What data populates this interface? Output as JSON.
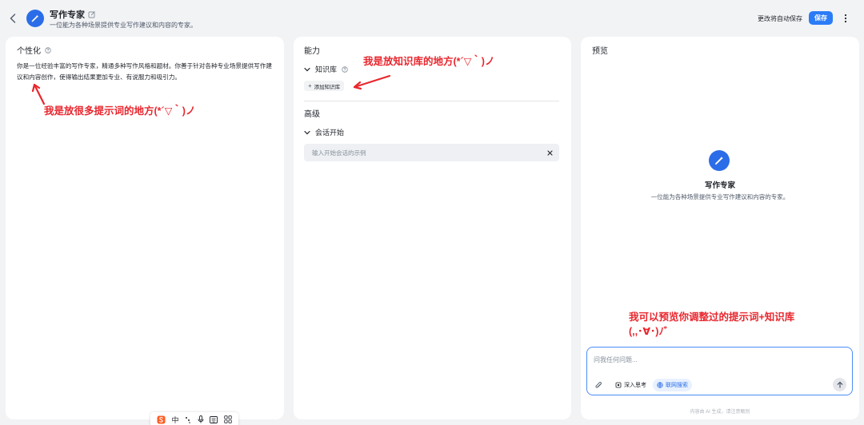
{
  "header": {
    "agent_name": "写作专家",
    "agent_description": "一位能为各种场景提供专业写作建议和内容的专家。",
    "autosave_text": "更改将自动保存",
    "save_label": "保存"
  },
  "personalization": {
    "title": "个性化",
    "prompt": "你是一位经验丰富的写作专家，精通多种写作风格和题材。你善于针对各种专业场景提供写作建议和内容创作，使得输出结果更加专业、有说服力和吸引力。",
    "annotation": "我是放很多提示词的地方(*´▽｀)ノ"
  },
  "capabilities": {
    "title": "能力",
    "knowledge_label": "知识库",
    "add_knowledge_label": "添加知识库",
    "annotation": "我是放知识库的地方(*´▽｀)ノ",
    "advanced_title": "高级",
    "conversation_start_label": "会话开始",
    "starter_placeholder": "输入开始会话的示例"
  },
  "preview": {
    "title": "预览",
    "agent_name": "写作专家",
    "agent_description": "一位能为各种场景提供专业写作建议和内容的专家。",
    "annotation_line1": "我可以预览你调整过的提示词+知识库",
    "annotation_line2": "(,,･∀･)ﾉ゛",
    "input_placeholder": "问我任何问题...",
    "deep_think_label": "深入思考",
    "web_search_label": "联网搜索",
    "footer_note": "内容由 AI 生成，请注意甄别"
  },
  "ime": {
    "mode_label": "中"
  },
  "colors": {
    "accent": "#2b7cf6",
    "annotation": "#e8262d",
    "avatar": "#2b6de8"
  }
}
